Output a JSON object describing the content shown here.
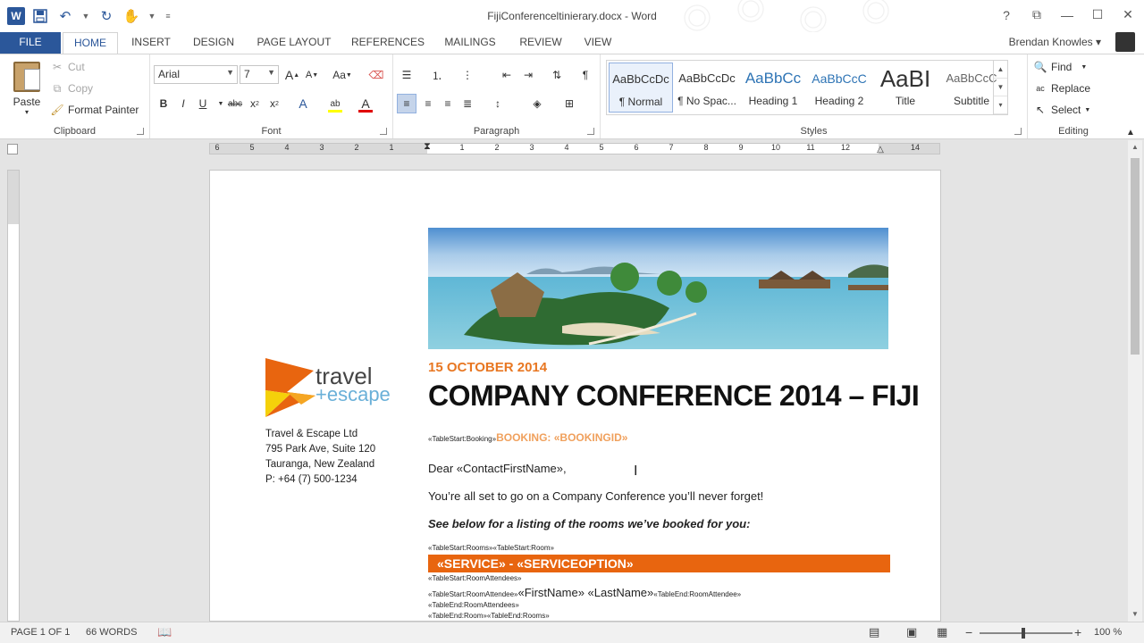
{
  "titlebar": {
    "app_logo": "W",
    "doc_title": "FijiConferenceltinierary.docx - Word",
    "help": "?",
    "min": "—",
    "max": "☐",
    "close": "✕"
  },
  "tabs": [
    "FILE",
    "HOME",
    "INSERT",
    "DESIGN",
    "PAGE LAYOUT",
    "REFERENCES",
    "MAILINGS",
    "REVIEW",
    "VIEW"
  ],
  "user": "Brendan Knowles",
  "clipboard": {
    "paste": "Paste",
    "cut": "Cut",
    "copy": "Copy",
    "format_painter": "Format Painter",
    "label": "Clipboard"
  },
  "font": {
    "family": "Arial",
    "size": "7",
    "label": "Font",
    "grow": "A",
    "shrink": "A",
    "change_case": "Aa",
    "bold": "B",
    "italic": "I",
    "underline": "U",
    "strike": "abc",
    "subscript": "x",
    "superscript": "x",
    "effects": "A",
    "highlight": "ab",
    "font_color": "A"
  },
  "paragraph": {
    "label": "Paragraph"
  },
  "styles": {
    "label": "Styles",
    "items": [
      {
        "preview": "AaBbCcDc",
        "name": "¶ Normal"
      },
      {
        "preview": "AaBbCcDc",
        "name": "¶ No Spac..."
      },
      {
        "preview": "AaBbCc",
        "name": "Heading 1"
      },
      {
        "preview": "AaBbCcC",
        "name": "Heading 2"
      },
      {
        "preview": "AaBI",
        "name": "Title"
      },
      {
        "preview": "AaBbCcC",
        "name": "Subtitle"
      }
    ]
  },
  "editing": {
    "label": "Editing",
    "find": "Find",
    "replace": "Replace",
    "select": "Select"
  },
  "ruler": {
    "labels": [
      "6",
      "5",
      "4",
      "3",
      "2",
      "1",
      "1",
      "2",
      "3",
      "4",
      "5",
      "6",
      "7",
      "8",
      "9",
      "10",
      "11",
      "12",
      "13",
      "14"
    ]
  },
  "document": {
    "company": "Travel & Escape Ltd",
    "address1": "795 Park Ave, Suite 120",
    "address2": "Tauranga, New Zealand",
    "phone": "P: +64 (7) 500-1234",
    "logo_main": "travel",
    "logo_sub": "+escape",
    "date": "15 OCTOBER 2014",
    "heading": "COMPANY CONFERENCE 2014 – FIJI",
    "booking_prefix": "«TableStart:Booking»",
    "booking": "BOOKING: «BOOKINGID»",
    "greeting": "Dear «ContactFirstName»,",
    "intro": "You’re all set to go on a Company Conference you’ll never forget!",
    "listing": "See below for a listing of the rooms we’ve booked for you:",
    "rooms_start": "«TableStart:Rooms»«TableStart:Room»",
    "service": "«SERVICE» - «SERVICEOPTION»",
    "attendees_start": "«TableStart:RoomAttendees»",
    "attendee_start": "«TableStart:RoomAttendee»",
    "names": "«FirstName» «LastName»",
    "attendee_end": "«TableEnd:RoomAttendee»",
    "attendees_end": "«TableEnd:RoomAttendees»",
    "rooms_end": "«TableEnd:Room»«TableEnd:Rooms»"
  },
  "status": {
    "page": "PAGE 1 OF 1",
    "words": "66 WORDS",
    "zoom": "100 %",
    "zoom_out": "−",
    "zoom_in": "+"
  }
}
